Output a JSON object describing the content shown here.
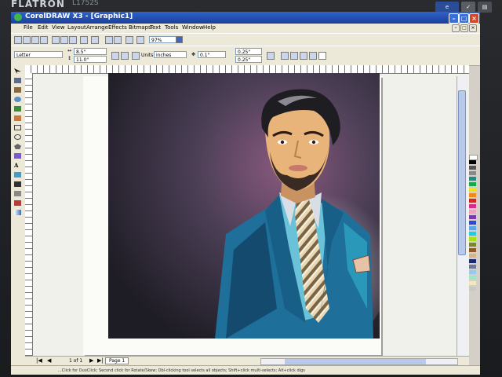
{
  "monitor": {
    "brand": "FLATRON",
    "model": "L1752S"
  },
  "window": {
    "title": "CorelDRAW X3 - [Graphic1]"
  },
  "menu": [
    "File",
    "Edit",
    "View",
    "Layout",
    "Arrange",
    "Effects",
    "Bitmaps",
    "Text",
    "Tools",
    "Window",
    "Help"
  ],
  "toolbar": {
    "zoom_value": "97%"
  },
  "property_bar": {
    "paper_preset": "Letter",
    "width_value": "8.5\"",
    "height_value": "11.0\"",
    "units_label": "Units:",
    "units_value": "inches",
    "nudge_value": "0.1\"",
    "dup_x_value": "0.25\"",
    "dup_y_value": "0.25\""
  },
  "document": {
    "page_counter": "1 of 1",
    "page_tab": "Page 1"
  },
  "status": {
    "hint": "...Click for DuoClick; Second click for Rotate/Skew; Dbl-clicking tool selects all objects; Shift+click multi-selects; Alt+click digs"
  },
  "colors": {
    "titlebar": "#2450b8",
    "chrome": "#ece9d8",
    "desktop": "#f1f1ec"
  }
}
